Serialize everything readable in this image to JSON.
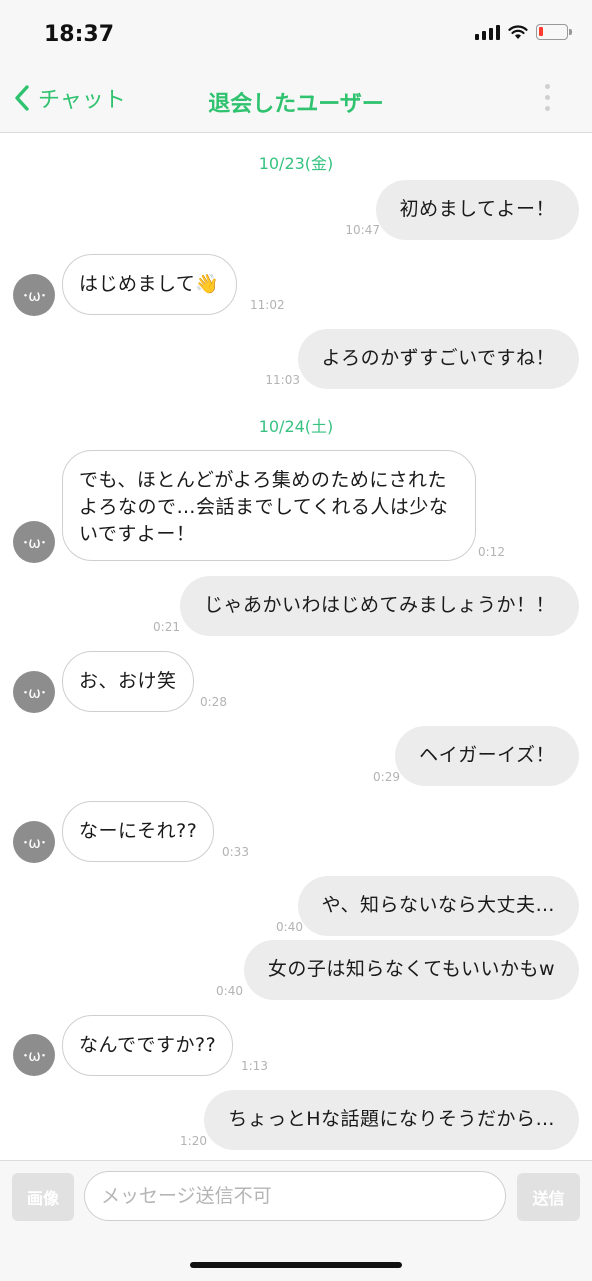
{
  "status": {
    "time": "18:37"
  },
  "nav": {
    "back_label": "チャット",
    "title": "退会したユーザー"
  },
  "avatar_text": "･ω･",
  "dates": [
    "10/23(金)",
    "10/24(土)"
  ],
  "messages": [
    {
      "from": "me",
      "text": "初めましてよー！",
      "time": "10:47"
    },
    {
      "from": "them",
      "text": "はじめまして👋",
      "time": "11:02"
    },
    {
      "from": "me",
      "text": "よろのかずすごいですね！",
      "time": "11:03"
    },
    {
      "from": "them",
      "text": "でも、ほとんどがよろ集めのためにされたよろなので…会話までしてくれる人は少ないですよー！",
      "time": "0:12"
    },
    {
      "from": "me",
      "text": "じゃあかいわはじめてみましょうか！！",
      "time": "0:21"
    },
    {
      "from": "them",
      "text": "お、おけ笑",
      "time": "0:28"
    },
    {
      "from": "me",
      "text": "ヘイガーイズ！",
      "time": "0:29"
    },
    {
      "from": "them",
      "text": "なーにそれ??",
      "time": "0:33"
    },
    {
      "from": "me",
      "text": "や、知らないなら大丈夫…",
      "time": "0:40"
    },
    {
      "from": "me",
      "text": "女の子は知らなくてもいいかもw",
      "time": "0:40"
    },
    {
      "from": "them",
      "text": "なんでですか??",
      "time": "1:13"
    },
    {
      "from": "me",
      "text": "ちょっとHな話題になりそうだから…",
      "time": "1:20"
    }
  ],
  "input": {
    "image_button": "画像",
    "placeholder": "メッセージ送信不可",
    "value": "",
    "send_button": "送信"
  },
  "colors": {
    "accent": "#2fc26f",
    "date": "#38c281",
    "my_bubble": "#ececec",
    "avatar": "#8d8d8d"
  }
}
